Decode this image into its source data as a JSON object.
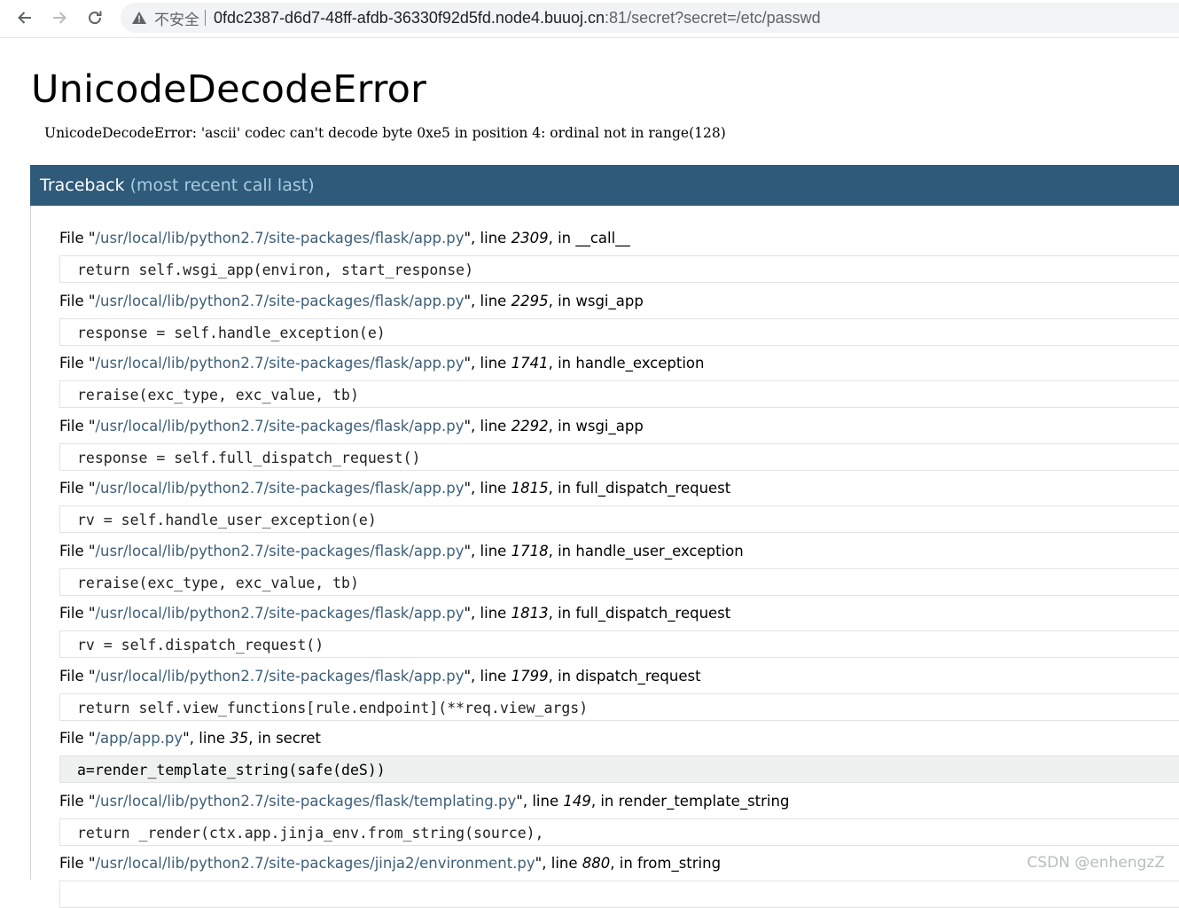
{
  "browser": {
    "security_label": "不安全",
    "url_host": "0fdc2387-d6d7-48ff-afdb-36330f92d5fd.node4.buuoj.cn",
    "url_rest": ":81/secret?secret=/etc/passwd"
  },
  "page": {
    "title": "UnicodeDecodeError",
    "message": "UnicodeDecodeError: 'ascii' codec can't decode byte 0xe5 in position 4: ordinal not in range(128)",
    "traceback_label": "Traceback",
    "traceback_hint": "(most recent call last)"
  },
  "frames": [
    {
      "file_label": "File \"",
      "path": "/usr/local/lib/python2.7/site-packages/flask/app.py",
      "mid": "\", line ",
      "line": "2309",
      "in": ", in ",
      "func": "__call__",
      "code": "return self.wsgi_app(environ, start_response)"
    },
    {
      "file_label": "File \"",
      "path": "/usr/local/lib/python2.7/site-packages/flask/app.py",
      "mid": "\", line ",
      "line": "2295",
      "in": ", in ",
      "func": "wsgi_app",
      "code": "response = self.handle_exception(e)"
    },
    {
      "file_label": "File \"",
      "path": "/usr/local/lib/python2.7/site-packages/flask/app.py",
      "mid": "\", line ",
      "line": "1741",
      "in": ", in ",
      "func": "handle_exception",
      "code": "reraise(exc_type, exc_value, tb)"
    },
    {
      "file_label": "File \"",
      "path": "/usr/local/lib/python2.7/site-packages/flask/app.py",
      "mid": "\", line ",
      "line": "2292",
      "in": ", in ",
      "func": "wsgi_app",
      "code": "response = self.full_dispatch_request()"
    },
    {
      "file_label": "File \"",
      "path": "/usr/local/lib/python2.7/site-packages/flask/app.py",
      "mid": "\", line ",
      "line": "1815",
      "in": ", in ",
      "func": "full_dispatch_request",
      "code": "rv = self.handle_user_exception(e)"
    },
    {
      "file_label": "File \"",
      "path": "/usr/local/lib/python2.7/site-packages/flask/app.py",
      "mid": "\", line ",
      "line": "1718",
      "in": ", in ",
      "func": "handle_user_exception",
      "code": "reraise(exc_type, exc_value, tb)"
    },
    {
      "file_label": "File \"",
      "path": "/usr/local/lib/python2.7/site-packages/flask/app.py",
      "mid": "\", line ",
      "line": "1813",
      "in": ", in ",
      "func": "full_dispatch_request",
      "code": "rv = self.dispatch_request()"
    },
    {
      "file_label": "File \"",
      "path": "/usr/local/lib/python2.7/site-packages/flask/app.py",
      "mid": "\", line ",
      "line": "1799",
      "in": ", in ",
      "func": "dispatch_request",
      "code": "return self.view_functions[rule.endpoint](**req.view_args)"
    },
    {
      "file_label": "File \"",
      "path": "/app/app.py",
      "mid": "\", line ",
      "line": "35",
      "in": ", in ",
      "func": "secret",
      "code": "a=render_template_string(safe(deS))"
    },
    {
      "file_label": "File \"",
      "path": "/usr/local/lib/python2.7/site-packages/flask/templating.py",
      "mid": "\", line ",
      "line": "149",
      "in": ", in ",
      "func": "render_template_string",
      "code": "return _render(ctx.app.jinja_env.from_string(source),"
    },
    {
      "file_label": "File \"",
      "path": "/usr/local/lib/python2.7/site-packages/jinja2/environment.py",
      "mid": "\", line ",
      "line": "880",
      "in": ", in ",
      "func": "from_string",
      "code": ""
    }
  ],
  "watermark": "CSDN @enhengzZ"
}
